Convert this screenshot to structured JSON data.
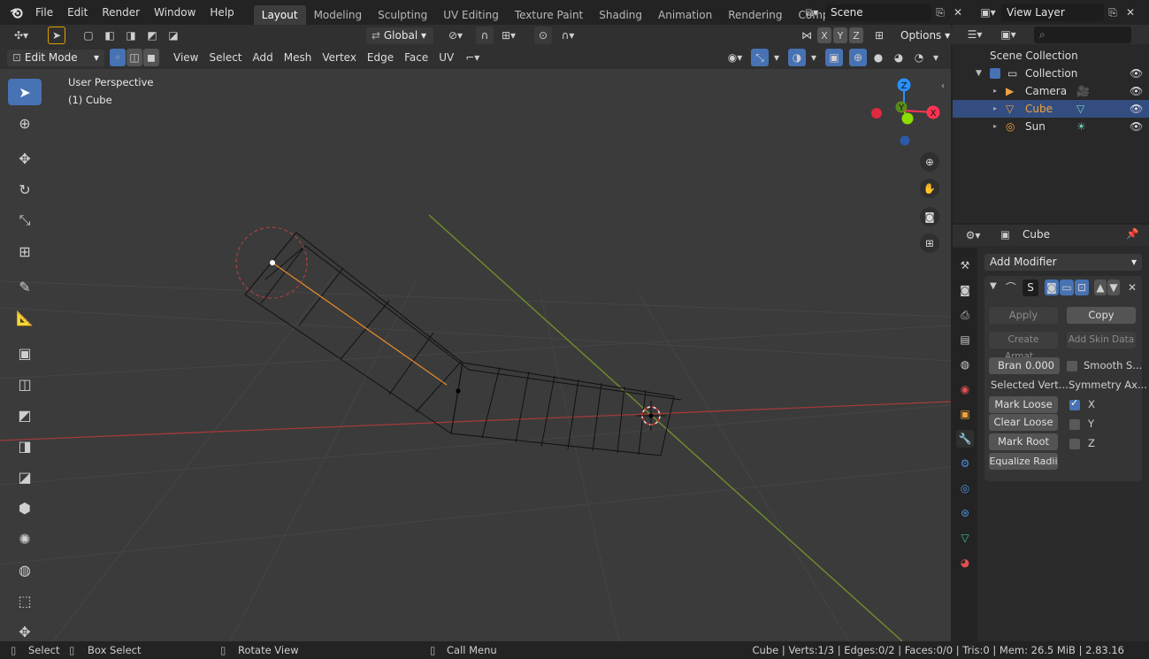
{
  "top_menu": [
    "File",
    "Edit",
    "Render",
    "Window",
    "Help"
  ],
  "workspace_tabs": [
    "Layout",
    "Modeling",
    "Sculpting",
    "UV Editing",
    "Texture Paint",
    "Shading",
    "Animation",
    "Rendering",
    "Compositing",
    "S"
  ],
  "active_workspace": "Layout",
  "scene_name": "Scene",
  "view_layer_name": "View Layer",
  "transform_orientation": "Global",
  "options_label": "Options",
  "axis_buttons": [
    "X",
    "Y",
    "Z"
  ],
  "viewport_header": {
    "mode": "Edit Mode",
    "menus": [
      "View",
      "Select",
      "Add",
      "Mesh",
      "Vertex",
      "Edge",
      "Face",
      "UV"
    ]
  },
  "viewport_overlay": {
    "perspective": "User Perspective",
    "object": "(1) Cube"
  },
  "gizmo_axes": {
    "z": "Z",
    "y": "Y",
    "x": "X"
  },
  "outliner": {
    "root": "Scene Collection",
    "collection": "Collection",
    "objects": [
      {
        "name": "Camera",
        "selected": false
      },
      {
        "name": "Cube",
        "selected": true
      },
      {
        "name": "Sun",
        "selected": false
      }
    ]
  },
  "properties": {
    "object_name": "Cube",
    "add_modifier": "Add Modifier",
    "modifier_short_name": "S",
    "apply": "Apply",
    "copy": "Copy",
    "create_armature": "Create Armat...",
    "add_skin_data": "Add Skin Data",
    "branch_label": "Bran",
    "branch_value": "0.000",
    "smooth_shading": "Smooth S...",
    "selected_vertices": "Selected Vert...",
    "symmetry_axes": "Symmetry Ax...",
    "mark_loose": "Mark Loose",
    "clear_loose": "Clear Loose",
    "mark_root": "Mark Root",
    "equalize_radii": "Equalize Radii",
    "axes": [
      {
        "name": "X",
        "checked": true
      },
      {
        "name": "Y",
        "checked": false
      },
      {
        "name": "Z",
        "checked": false
      }
    ]
  },
  "statusbar": {
    "select": "Select",
    "box_select": "Box Select",
    "rotate_view": "Rotate View",
    "call_menu": "Call Menu",
    "stats": "Cube | Verts:1/3 | Edges:0/2 | Faces:0/0 | Tris:0 | Mem: 26.5 MiB | 2.83.16"
  },
  "colors": {
    "accent": "#4772b3",
    "selected_object": "#f0a23c",
    "x_axis": "#ff3352",
    "y_axis": "#8bdc00",
    "z_axis": "#2890ff"
  }
}
